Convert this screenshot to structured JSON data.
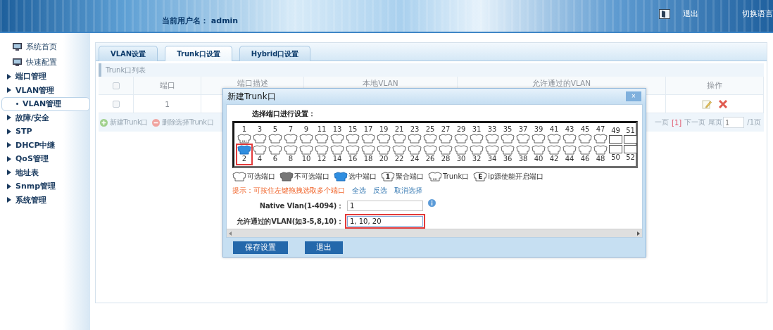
{
  "header": {
    "user_label": "当前用户名：",
    "user_name": "admin",
    "links": [
      "退出",
      "切换语言"
    ]
  },
  "sidebar": {
    "items": [
      {
        "label": "系统首页",
        "kind": "link",
        "selected": false
      },
      {
        "label": "快速配置",
        "kind": "link",
        "selected": false
      },
      {
        "label": "端口管理",
        "kind": "group",
        "selected": false
      },
      {
        "label": "VLAN管理",
        "kind": "group",
        "selected": false,
        "children": [
          {
            "label": "VLAN管理",
            "kind": "child",
            "selected": true
          }
        ]
      },
      {
        "label": "故障/安全",
        "kind": "group",
        "selected": false
      },
      {
        "label": "STP",
        "kind": "group",
        "selected": false
      },
      {
        "label": "DHCP中继",
        "kind": "group",
        "selected": false
      },
      {
        "label": "QoS管理",
        "kind": "group",
        "selected": false
      },
      {
        "label": "地址表",
        "kind": "group",
        "selected": false
      },
      {
        "label": "Snmp管理",
        "kind": "group",
        "selected": false
      },
      {
        "label": "系统管理",
        "kind": "group",
        "selected": false
      }
    ]
  },
  "tabs": [
    {
      "label": "VLAN设置",
      "selected": false
    },
    {
      "label": "Trunk口设置",
      "selected": true
    },
    {
      "label": "Hybrid口设置",
      "selected": false
    }
  ],
  "list": {
    "title": "Trunk口列表",
    "columns": [
      {
        "kind": "checkbox",
        "checked": false
      },
      {
        "kind": "text",
        "label": "端口"
      },
      {
        "kind": "text",
        "label": "端口描述"
      },
      {
        "kind": "text",
        "label": "本地VLAN"
      },
      {
        "kind": "text",
        "label": "允许通过的VLAN"
      },
      {
        "kind": "text",
        "label": "操作"
      }
    ],
    "rows": [
      {
        "checked": false,
        "port": "1"
      }
    ],
    "actions": [
      {
        "kind": "add",
        "label": "新建Trunk口"
      },
      {
        "kind": "remove",
        "label": "删除选择Trunk口"
      }
    ],
    "pagination": {
      "prev": "一页",
      "current": "[1]",
      "next": "下一页",
      "last": "尾页",
      "page_value": "1",
      "total": "/1页"
    }
  },
  "dialog": {
    "title": "新建Trunk口",
    "close": "×",
    "prompt": "选择端口进行设置：",
    "ports": [
      {
        "label": "1",
        "kind": "copper",
        "selected": false,
        "trunk": true,
        "highlighted": false
      },
      {
        "label": "2",
        "kind": "copper",
        "selected": true,
        "trunk": false,
        "highlighted": true
      },
      {
        "label": "3",
        "kind": "copper",
        "selected": false,
        "trunk": false,
        "highlighted": false
      },
      {
        "label": "4",
        "kind": "copper",
        "selected": false,
        "trunk": false,
        "highlighted": false
      },
      {
        "label": "5",
        "kind": "copper",
        "selected": false,
        "trunk": false,
        "highlighted": false
      },
      {
        "label": "6",
        "kind": "copper",
        "selected": false,
        "trunk": false,
        "highlighted": false
      },
      {
        "label": "7",
        "kind": "copper",
        "selected": false,
        "trunk": false,
        "highlighted": false
      },
      {
        "label": "8",
        "kind": "copper",
        "selected": false,
        "trunk": false,
        "highlighted": false
      },
      {
        "label": "9",
        "kind": "copper",
        "selected": false,
        "trunk": false,
        "highlighted": false
      },
      {
        "label": "10",
        "kind": "copper",
        "selected": false,
        "trunk": false,
        "highlighted": false
      },
      {
        "label": "11",
        "kind": "copper",
        "selected": false,
        "trunk": false,
        "highlighted": false
      },
      {
        "label": "12",
        "kind": "copper",
        "selected": false,
        "trunk": false,
        "highlighted": false
      },
      {
        "label": "13",
        "kind": "copper",
        "selected": false,
        "trunk": false,
        "highlighted": false
      },
      {
        "label": "14",
        "kind": "copper",
        "selected": false,
        "trunk": false,
        "highlighted": false
      },
      {
        "label": "15",
        "kind": "copper",
        "selected": false,
        "trunk": false,
        "highlighted": false
      },
      {
        "label": "16",
        "kind": "copper",
        "selected": false,
        "trunk": false,
        "highlighted": false
      },
      {
        "label": "17",
        "kind": "copper",
        "selected": false,
        "trunk": false,
        "highlighted": false
      },
      {
        "label": "18",
        "kind": "copper",
        "selected": false,
        "trunk": false,
        "highlighted": false
      },
      {
        "label": "19",
        "kind": "copper",
        "selected": false,
        "trunk": false,
        "highlighted": false
      },
      {
        "label": "20",
        "kind": "copper",
        "selected": false,
        "trunk": false,
        "highlighted": false
      },
      {
        "label": "21",
        "kind": "copper",
        "selected": false,
        "trunk": false,
        "highlighted": false
      },
      {
        "label": "22",
        "kind": "copper",
        "selected": false,
        "trunk": false,
        "highlighted": false
      },
      {
        "label": "23",
        "kind": "copper",
        "selected": false,
        "trunk": false,
        "highlighted": false
      },
      {
        "label": "24",
        "kind": "copper",
        "selected": false,
        "trunk": false,
        "highlighted": false
      },
      {
        "label": "25",
        "kind": "copper",
        "selected": false,
        "trunk": false,
        "highlighted": false
      },
      {
        "label": "26",
        "kind": "copper",
        "selected": false,
        "trunk": false,
        "highlighted": false
      },
      {
        "label": "27",
        "kind": "copper",
        "selected": false,
        "trunk": false,
        "highlighted": false
      },
      {
        "label": "28",
        "kind": "copper",
        "selected": false,
        "trunk": false,
        "highlighted": false
      },
      {
        "label": "29",
        "kind": "copper",
        "selected": false,
        "trunk": false,
        "highlighted": false
      },
      {
        "label": "30",
        "kind": "copper",
        "selected": false,
        "trunk": false,
        "highlighted": false
      },
      {
        "label": "31",
        "kind": "copper",
        "selected": false,
        "trunk": false,
        "highlighted": false
      },
      {
        "label": "32",
        "kind": "copper",
        "selected": false,
        "trunk": false,
        "highlighted": false
      },
      {
        "label": "33",
        "kind": "copper",
        "selected": false,
        "trunk": false,
        "highlighted": false
      },
      {
        "label": "34",
        "kind": "copper",
        "selected": false,
        "trunk": false,
        "highlighted": false
      },
      {
        "label": "35",
        "kind": "copper",
        "selected": false,
        "trunk": false,
        "highlighted": false
      },
      {
        "label": "36",
        "kind": "copper",
        "selected": false,
        "trunk": false,
        "highlighted": false
      },
      {
        "label": "37",
        "kind": "copper",
        "selected": false,
        "trunk": false,
        "highlighted": false
      },
      {
        "label": "38",
        "kind": "copper",
        "selected": false,
        "trunk": false,
        "highlighted": false
      },
      {
        "label": "39",
        "kind": "copper",
        "selected": false,
        "trunk": false,
        "highlighted": false
      },
      {
        "label": "40",
        "kind": "copper",
        "selected": false,
        "trunk": false,
        "highlighted": false
      },
      {
        "label": "41",
        "kind": "copper",
        "selected": false,
        "trunk": false,
        "highlighted": false
      },
      {
        "label": "42",
        "kind": "copper",
        "selected": false,
        "trunk": false,
        "highlighted": false
      },
      {
        "label": "43",
        "kind": "copper",
        "selected": false,
        "trunk": false,
        "highlighted": false
      },
      {
        "label": "44",
        "kind": "copper",
        "selected": false,
        "trunk": false,
        "highlighted": false
      },
      {
        "label": "45",
        "kind": "copper",
        "selected": false,
        "trunk": false,
        "highlighted": false
      },
      {
        "label": "46",
        "kind": "copper",
        "selected": false,
        "trunk": false,
        "highlighted": false
      },
      {
        "label": "47",
        "kind": "copper",
        "selected": false,
        "trunk": false,
        "highlighted": false
      },
      {
        "label": "48",
        "kind": "copper",
        "selected": false,
        "trunk": false,
        "highlighted": false
      },
      {
        "label": "49",
        "kind": "fiber",
        "selected": false,
        "trunk": false,
        "highlighted": false
      },
      {
        "label": "50",
        "kind": "fiber",
        "selected": false,
        "trunk": false,
        "highlighted": false
      },
      {
        "label": "51",
        "kind": "fiber",
        "selected": false,
        "trunk": false,
        "highlighted": false
      },
      {
        "label": "52",
        "kind": "fiber",
        "selected": false,
        "trunk": false,
        "highlighted": false
      }
    ],
    "legend": [
      {
        "kind": "available",
        "label": "可选端口"
      },
      {
        "kind": "disabled",
        "label": "不可选端口"
      },
      {
        "kind": "selected",
        "label": "选中端口"
      },
      {
        "kind": "aggregate",
        "mark": "1",
        "label": "聚合端口"
      },
      {
        "kind": "trunk",
        "label": "Trunk口"
      },
      {
        "kind": "ipsource",
        "mark": "E",
        "label": "ip源使能开启端口"
      }
    ],
    "hint": "提示：可按住左键拖拽选取多个端口",
    "selection_links": [
      "全选",
      "反选",
      "取消选择"
    ],
    "fields": [
      {
        "label": "Native Vlan(1-4094)：",
        "value": "1",
        "info": true,
        "highlighted": false
      },
      {
        "label": "允许通过的VLAN(如3-5,8,10)：",
        "value": "1, 10, 20",
        "info": false,
        "highlighted": true
      }
    ],
    "buttons": [
      "保存设置",
      "退出"
    ]
  }
}
